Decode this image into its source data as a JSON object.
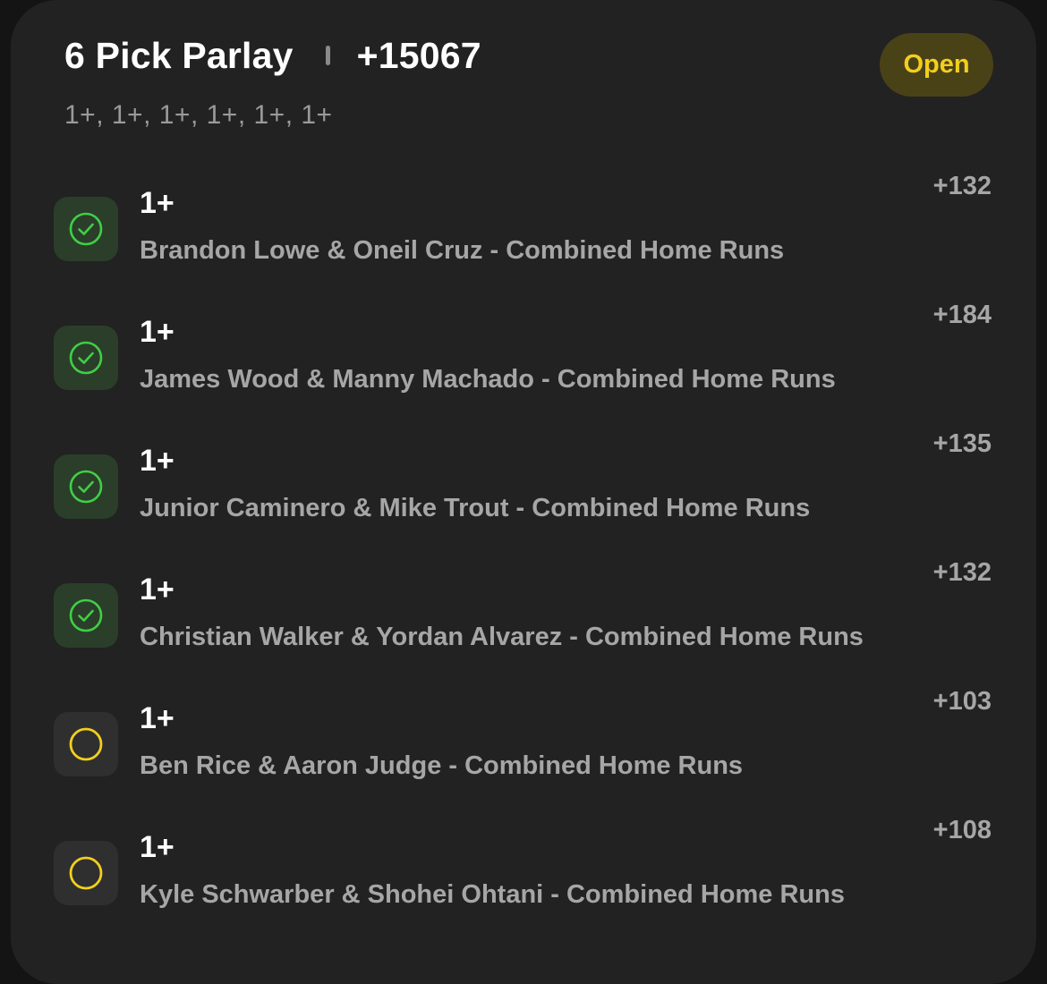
{
  "header": {
    "title": "6 Pick Parlay",
    "odds": "+15067",
    "status": "Open",
    "summary": "1+, 1+, 1+, 1+, 1+, 1+"
  },
  "legs": [
    {
      "line": "1+",
      "description": "Brandon Lowe & Oneil Cruz - Combined Home Runs",
      "odds": "+132",
      "status": "won",
      "icon": "check-circle-icon"
    },
    {
      "line": "1+",
      "description": "James Wood & Manny Machado - Combined Home Runs",
      "odds": "+184",
      "status": "won",
      "icon": "check-circle-icon"
    },
    {
      "line": "1+",
      "description": "Junior Caminero & Mike Trout - Combined Home Runs",
      "odds": "+135",
      "status": "won",
      "icon": "check-circle-icon"
    },
    {
      "line": "1+",
      "description": "Christian Walker & Yordan Alvarez - Combined Home Runs",
      "odds": "+132",
      "status": "won",
      "icon": "check-circle-icon"
    },
    {
      "line": "1+",
      "description": "Ben Rice & Aaron Judge - Combined Home Runs",
      "odds": "+103",
      "status": "pending",
      "icon": "pending-circle-icon"
    },
    {
      "line": "1+",
      "description": "Kyle Schwarber & Shohei Ohtani - Combined Home Runs",
      "odds": "+108",
      "status": "pending",
      "icon": "pending-circle-icon"
    }
  ],
  "colors": {
    "won": "#3fcf45",
    "pending": "#f2cf1d",
    "badge_bg": "#4a4217"
  }
}
